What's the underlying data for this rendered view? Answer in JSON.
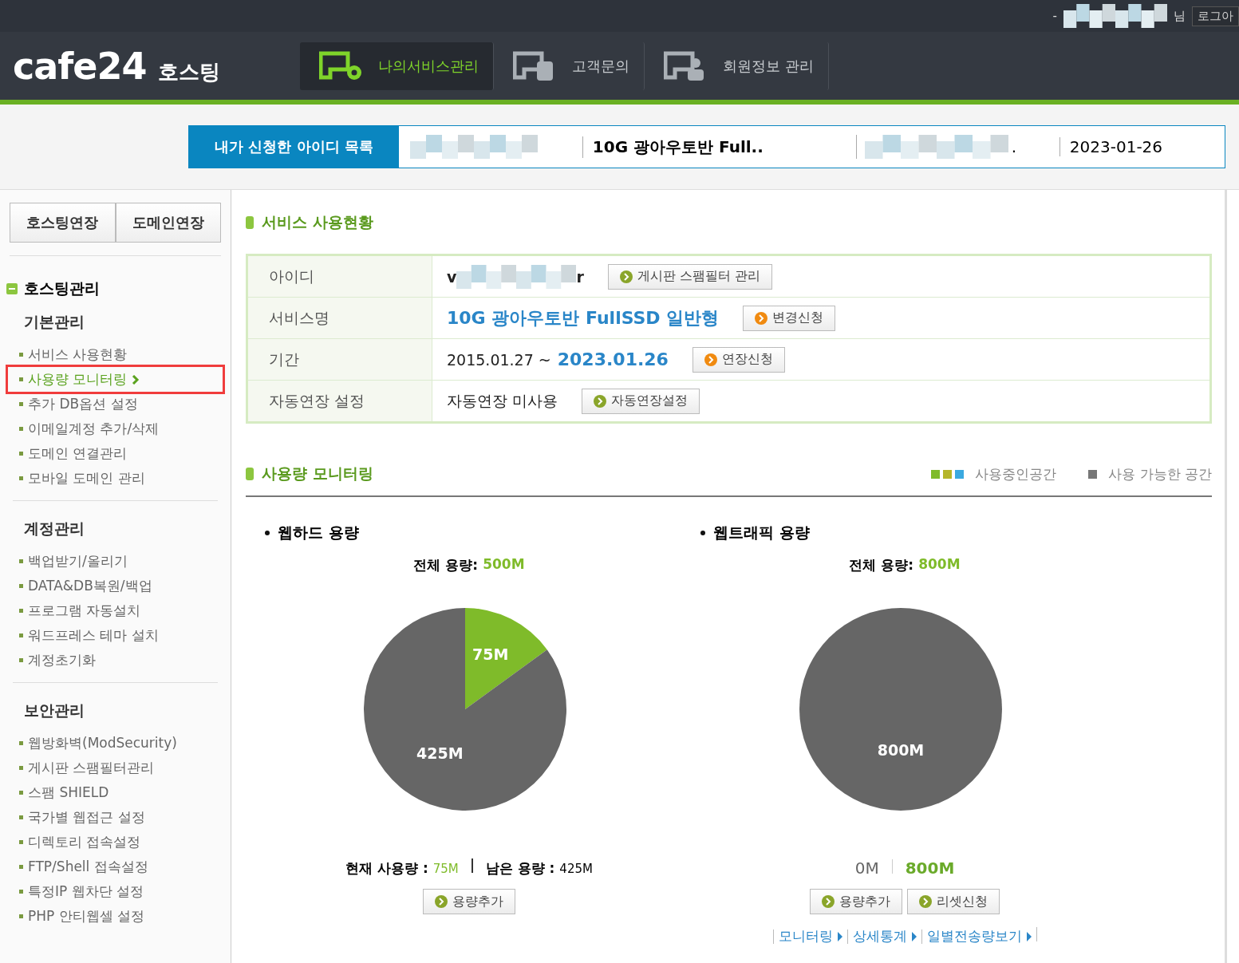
{
  "top_bar": {
    "dash": "-",
    "suffix": "님",
    "logout": "로그아"
  },
  "header": {
    "logo": "cafe24",
    "logo_sub": "호스팅",
    "nav": [
      {
        "label": "나의서비스관리",
        "selected": true
      },
      {
        "label": "고객문의",
        "selected": false
      },
      {
        "label": "회원정보 관리",
        "selected": false
      }
    ]
  },
  "id_bar": {
    "title": "내가 신청한 아이디 목록",
    "service": "10G 광아우토반 Full..",
    "dot": ".",
    "date": "2023-01-26"
  },
  "sidebar": {
    "buttons": [
      "호스팅연장",
      "도메인연장"
    ],
    "heading": "호스팅관리",
    "groups": [
      {
        "title": "기본관리",
        "items": [
          {
            "label": "서비스 사용현황",
            "selected": false
          },
          {
            "label": "사용량 모니터링",
            "selected": true
          },
          {
            "label": "추가 DB옵션 설정",
            "selected": false
          },
          {
            "label": "이메일계정 추가/삭제",
            "selected": false
          },
          {
            "label": "도메인 연결관리",
            "selected": false
          },
          {
            "label": "모바일 도메인 관리",
            "selected": false
          }
        ]
      },
      {
        "title": "계정관리",
        "items": [
          {
            "label": "백업받기/올리기",
            "selected": false
          },
          {
            "label": "DATA&DB복원/백업",
            "selected": false
          },
          {
            "label": "프로그램 자동설치",
            "selected": false
          },
          {
            "label": "워드프레스 테마 설치",
            "selected": false
          },
          {
            "label": "계정초기화",
            "selected": false
          }
        ]
      },
      {
        "title": "보안관리",
        "items": [
          {
            "label": "웹방화벽(ModSecurity)",
            "selected": false
          },
          {
            "label": "게시판 스팸필터관리",
            "selected": false
          },
          {
            "label": "스팸 SHIELD",
            "selected": false
          },
          {
            "label": "국가별 웹접근 설정",
            "selected": false
          },
          {
            "label": "디렉토리 접속설정",
            "selected": false
          },
          {
            "label": "FTP/Shell 접속설정",
            "selected": false
          },
          {
            "label": "특정IP 웹차단 설정",
            "selected": false
          },
          {
            "label": "PHP 안티웹셀 설정",
            "selected": false
          }
        ]
      }
    ]
  },
  "service_status": {
    "title": "서비스 사용현황",
    "rows": [
      {
        "kind": "id",
        "label": "아이디",
        "prefix": "v",
        "suffix": "r",
        "button": {
          "label": "게시판 스팸필터 관리",
          "color": "#8aa52a"
        }
      },
      {
        "kind": "service",
        "label": "서비스명",
        "value": "10G 광아우토반 FullSSD 일반형",
        "button": {
          "label": "변경신청",
          "color": "#f08a10"
        }
      },
      {
        "kind": "period",
        "label": "기간",
        "start": "2015.01.27 ~",
        "end": "2023.01.26",
        "button": {
          "label": "연장신청",
          "color": "#f08a10"
        }
      },
      {
        "kind": "plain",
        "label": "자동연장 설정",
        "value": "자동연장 미사용",
        "button": {
          "label": "자동연장설정",
          "color": "#8aa52a"
        }
      }
    ]
  },
  "monitoring": {
    "title": "사용량 모니터링",
    "legend": [
      {
        "label": "사용중인공간",
        "swatches": [
          {
            "color": "#7fbb2a"
          },
          {
            "color": "#b5b52a"
          },
          {
            "color": "#3aa9e0"
          }
        ]
      },
      {
        "label": "사용 가능한 공간",
        "swatches": [
          {
            "color": "#777777"
          }
        ]
      }
    ],
    "panels": [
      {
        "kind": "disk",
        "title": "웹하드 용량",
        "total_label": "전체 용량:",
        "total": "500M",
        "chart_data": {
          "type": "pie",
          "values": [
            75,
            425
          ],
          "colors": [
            "#7fbb2a",
            "#666666"
          ],
          "value_labels": [
            "75M",
            "425M"
          ]
        },
        "used_label": "현재 사용량 :",
        "used": "75M",
        "remain_label": "남은 용량 :",
        "remain": "425M",
        "buttons": [
          "용량추가"
        ]
      },
      {
        "kind": "traffic",
        "title": "웹트래픽 용량",
        "total_label": "전체 용량:",
        "total": "800M",
        "chart_data": {
          "type": "pie",
          "values": [
            800
          ],
          "colors": [
            "#666666"
          ],
          "value_labels": [
            "800M"
          ]
        },
        "min": "0M",
        "max": "800M",
        "buttons": [
          "용량추가",
          "리셋신청"
        ],
        "links": [
          "모니터링",
          "상세통계",
          "일별전송량보기"
        ]
      }
    ]
  }
}
